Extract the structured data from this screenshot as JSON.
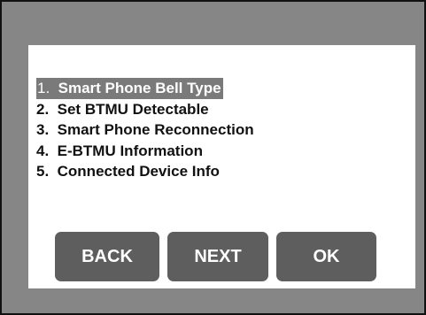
{
  "menu": {
    "items": [
      {
        "num": "1.",
        "label": "Smart Phone Bell Type",
        "selected": true
      },
      {
        "num": "2.",
        "label": "Set BTMU Detectable",
        "selected": false
      },
      {
        "num": "3.",
        "label": "Smart Phone Reconnection",
        "selected": false
      },
      {
        "num": "4.",
        "label": "E-BTMU Information",
        "selected": false
      },
      {
        "num": "5.",
        "label": "Connected Device Info",
        "selected": false
      }
    ]
  },
  "buttons": {
    "back": "BACK",
    "next": "NEXT",
    "ok": "OK"
  },
  "colors": {
    "frame_background": "#868686",
    "dialog_background": "#ffffff",
    "selection_highlight": "#7a7a7a",
    "button_background": "#5e5e5e",
    "button_text": "#ffffff"
  }
}
